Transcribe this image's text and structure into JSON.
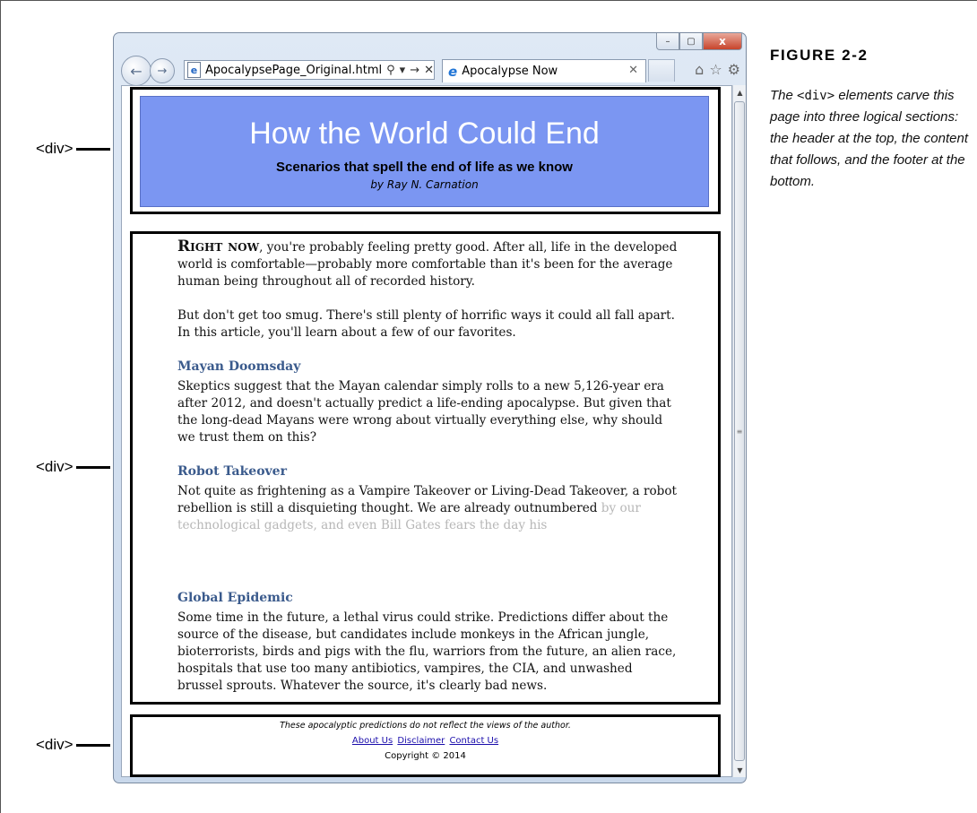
{
  "browser": {
    "address": "ApocalypsePage_Original.html",
    "tab_title": "Apocalypse Now",
    "window_buttons": [
      "–",
      "▢",
      "x"
    ]
  },
  "page": {
    "header": {
      "title": "How the World Could End",
      "subtitle": "Scenarios that spell the end of life as we know",
      "byline": "by Ray N. Carnation"
    },
    "content": {
      "intro_lead": "Right now",
      "intro_rest": ", you're probably feeling pretty good. After all, life in the developed world is comfortable—probably more comfortable than it's been for the average human being throughout all of recorded history.",
      "intro2": "But don't get too smug. There's still plenty of horrific ways it could all fall apart. In this article, you'll learn about a few of our favorites.",
      "sections": [
        {
          "heading": "Mayan Doomsday",
          "text": "Skeptics suggest that the Mayan calendar simply rolls to a new 5,126-year era after 2012, and doesn't actually predict a life-ending apocalypse. But given that the long-dead Mayans were wrong about virtually everything else, why should we trust them on this?"
        },
        {
          "heading": "Robot Takeover",
          "text": "Not quite as frightening as a Vampire Takeover or Living-Dead Takeover, a robot rebellion is still a disquieting thought. We are already outnumbered",
          "faded": "by our technological gadgets, and even Bill Gates fears the day his"
        },
        {
          "heading": "Global Epidemic",
          "text": "Some time in the future, a lethal virus could strike. Predictions differ about the source of the disease, but candidates include monkeys in the African jungle, bioterrorists, birds and pigs with the flu, warriors from the future, an alien race, hospitals that use too many antibiotics, vampires, the CIA, and unwashed brussel sprouts. Whatever the source, it's clearly bad news."
        }
      ]
    },
    "footer": {
      "disclaimer": "These apocalyptic predictions do not reflect the views of the author.",
      "links": [
        "About Us",
        "Disclaimer",
        "Contact Us"
      ],
      "copyright": "Copyright © 2014"
    }
  },
  "callouts": [
    "<div>",
    "<div>",
    "<div>"
  ],
  "figure": {
    "label": "FIGURE 2-2",
    "caption_pre": "The ",
    "caption_code": "<div>",
    "caption_post": " elements carve this page into three logical sections: the header at the top, the content that follows, and the footer at the bottom."
  }
}
